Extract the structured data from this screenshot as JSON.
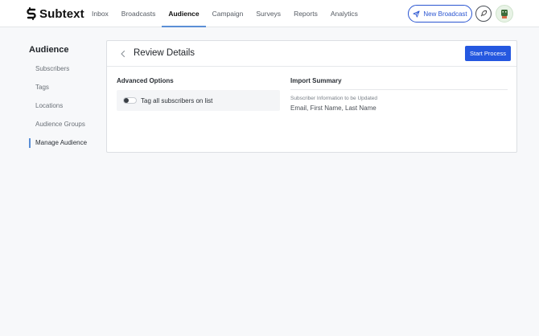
{
  "app": {
    "name": "Subtext"
  },
  "nav": {
    "items": [
      {
        "label": "Inbox",
        "active": false
      },
      {
        "label": "Broadcasts",
        "active": false
      },
      {
        "label": "Audience",
        "active": true
      },
      {
        "label": "Campaign",
        "active": false
      },
      {
        "label": "Surveys",
        "active": false
      },
      {
        "label": "Reports",
        "active": false
      },
      {
        "label": "Analytics",
        "active": false
      }
    ],
    "new_broadcast_label": "New Broadcast"
  },
  "sidebar": {
    "title": "Audience",
    "items": [
      {
        "label": "Subscribers",
        "active": false
      },
      {
        "label": "Tags",
        "active": false
      },
      {
        "label": "Locations",
        "active": false
      },
      {
        "label": "Audience Groups",
        "active": false
      },
      {
        "label": "Manage Audience",
        "active": true
      }
    ]
  },
  "card": {
    "title": "Review Details",
    "start_button_label": "Start Process",
    "advanced_options": {
      "heading": "Advanced Options",
      "tag_all_label": "Tag all subscribers on list",
      "tag_all_enabled": false
    },
    "import_summary": {
      "heading": "Import Summary",
      "subheading": "Subscriber Information to be Updated",
      "fields": "Email, First Name, Last Name"
    }
  },
  "colors": {
    "accent": "#2558e0",
    "nav_underline": "#5b8fd6",
    "background": "#f7f8fa"
  }
}
